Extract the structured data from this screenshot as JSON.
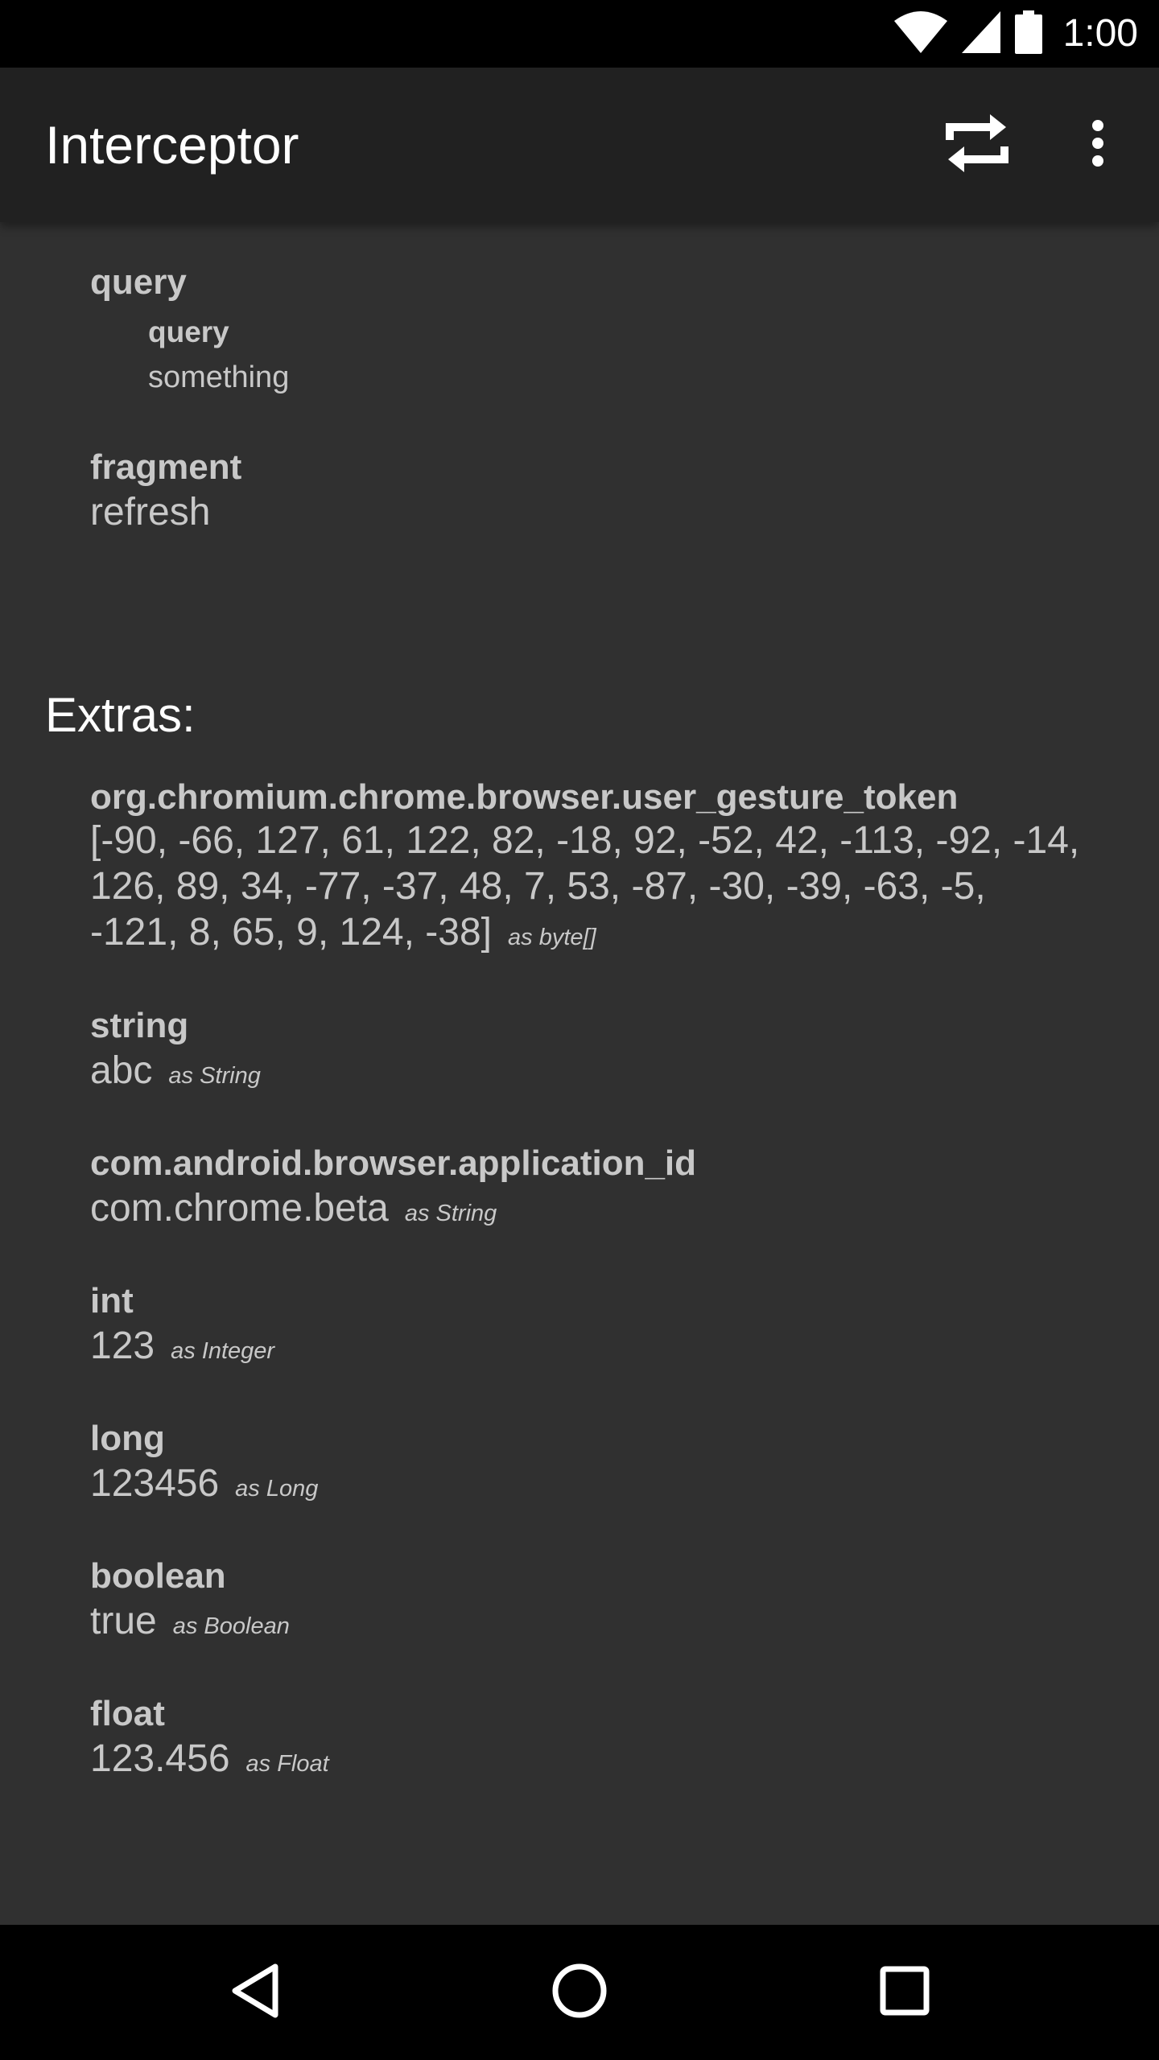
{
  "status_bar": {
    "time": "1:00",
    "icons": [
      "wifi-icon",
      "cell-signal-icon",
      "battery-icon"
    ]
  },
  "app_bar": {
    "title": "Interceptor",
    "actions": [
      "repeat-icon",
      "more-vert-icon"
    ]
  },
  "uri_parts": {
    "query": {
      "key": "query",
      "params": [
        {
          "name": "query",
          "value": "something"
        }
      ]
    },
    "fragment": {
      "key": "fragment",
      "value": "refresh"
    }
  },
  "extras": {
    "title": "Extras:",
    "items": [
      {
        "key": "org.chromium.chrome.browser.user_gesture_token",
        "value": "[-90, -66, 127, 61, 122, 82, -18, 92, -52, 42, -113, -92, -14, 126, 89, 34, -77, -37, 48, 7, 53, -87, -30, -39, -63, -5, -121, 8, 65, 9, 124, -38]",
        "type": "as byte[]"
      },
      {
        "key": "string",
        "value": "abc",
        "type": "as String"
      },
      {
        "key": "com.android.browser.application_id",
        "value": "com.chrome.beta",
        "type": "as String"
      },
      {
        "key": "int",
        "value": "123",
        "type": "as Integer"
      },
      {
        "key": "long",
        "value": "123456",
        "type": "as Long"
      },
      {
        "key": "boolean",
        "value": "true",
        "type": "as Boolean"
      },
      {
        "key": "float",
        "value": "123.456",
        "type": "as Float"
      }
    ]
  },
  "nav_bar": {
    "buttons": [
      "back-icon",
      "home-icon",
      "recents-icon"
    ]
  },
  "colors": {
    "background": "#303030",
    "app_bar": "#212121",
    "text": "#c8c8c8",
    "title_text": "#ffffff"
  }
}
